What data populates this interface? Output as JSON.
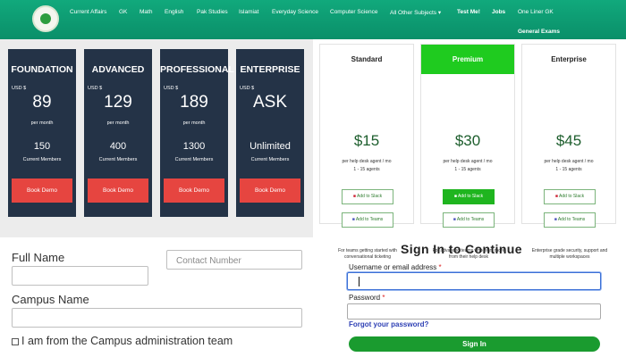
{
  "nav": {
    "items": [
      "Current Affairs",
      "GK",
      "Math",
      "English",
      "Pak Studies",
      "Islamiat",
      "Everyday Science",
      "Computer Science",
      "All Other Subjects ▾",
      "Test Me!",
      "Jobs",
      "One Liner GK",
      "General Exams"
    ]
  },
  "pricing_dark": {
    "plans": [
      {
        "name": "FOUNDATION",
        "currency": "USD $",
        "price": "89",
        "period": "per month",
        "members": "150",
        "members_label": "Current Members",
        "button": "Book Demo"
      },
      {
        "name": "ADVANCED",
        "currency": "USD $",
        "price": "129",
        "period": "per month",
        "members": "400",
        "members_label": "Current Members",
        "button": "Book Demo"
      },
      {
        "name": "PROFESSIONAL",
        "currency": "USD $",
        "price": "189",
        "period": "per month",
        "members": "1300",
        "members_label": "Current Members",
        "button": "Book Demo"
      },
      {
        "name": "ENTERPRISE",
        "currency": "USD $",
        "price": "ASK",
        "period": "",
        "members": "Unlimited",
        "members_label": "Current Members",
        "button": "Book Demo"
      }
    ]
  },
  "pricing_light": {
    "plans": [
      {
        "name": "Standard",
        "price": "$15",
        "line1": "per help desk agent / mo",
        "line2": "1 - 15 agents",
        "slack": "Add to Slack",
        "teams": "Add to Teams",
        "footer": "For teams getting started with conversational ticketing"
      },
      {
        "name": "Premium",
        "price": "$30",
        "line1": "per help desk agent / mo",
        "line2": "1 - 15 agents",
        "slack": "Add to Slack",
        "teams": "Add to Teams",
        "footer": "For advanced teams who want more from their help desk"
      },
      {
        "name": "Enterprise",
        "price": "$45",
        "line1": "per help desk agent / mo",
        "line2": "1 - 15 agents",
        "slack": "Add to Slack",
        "teams": "Add to Teams",
        "footer": "Enterprise grade security, support and multiple workspaces"
      }
    ]
  },
  "form": {
    "full_name_label": "Full Name",
    "contact_placeholder": "Contact Number",
    "campus_label": "Campus Name",
    "checkbox_label": "I am from the Campus administration team"
  },
  "signin": {
    "title": "Sign In to Continue",
    "username_label": "Username or email address",
    "password_label": "Password",
    "required_mark": "*",
    "forgot": "Forgot your password?",
    "button": "Sign In"
  }
}
